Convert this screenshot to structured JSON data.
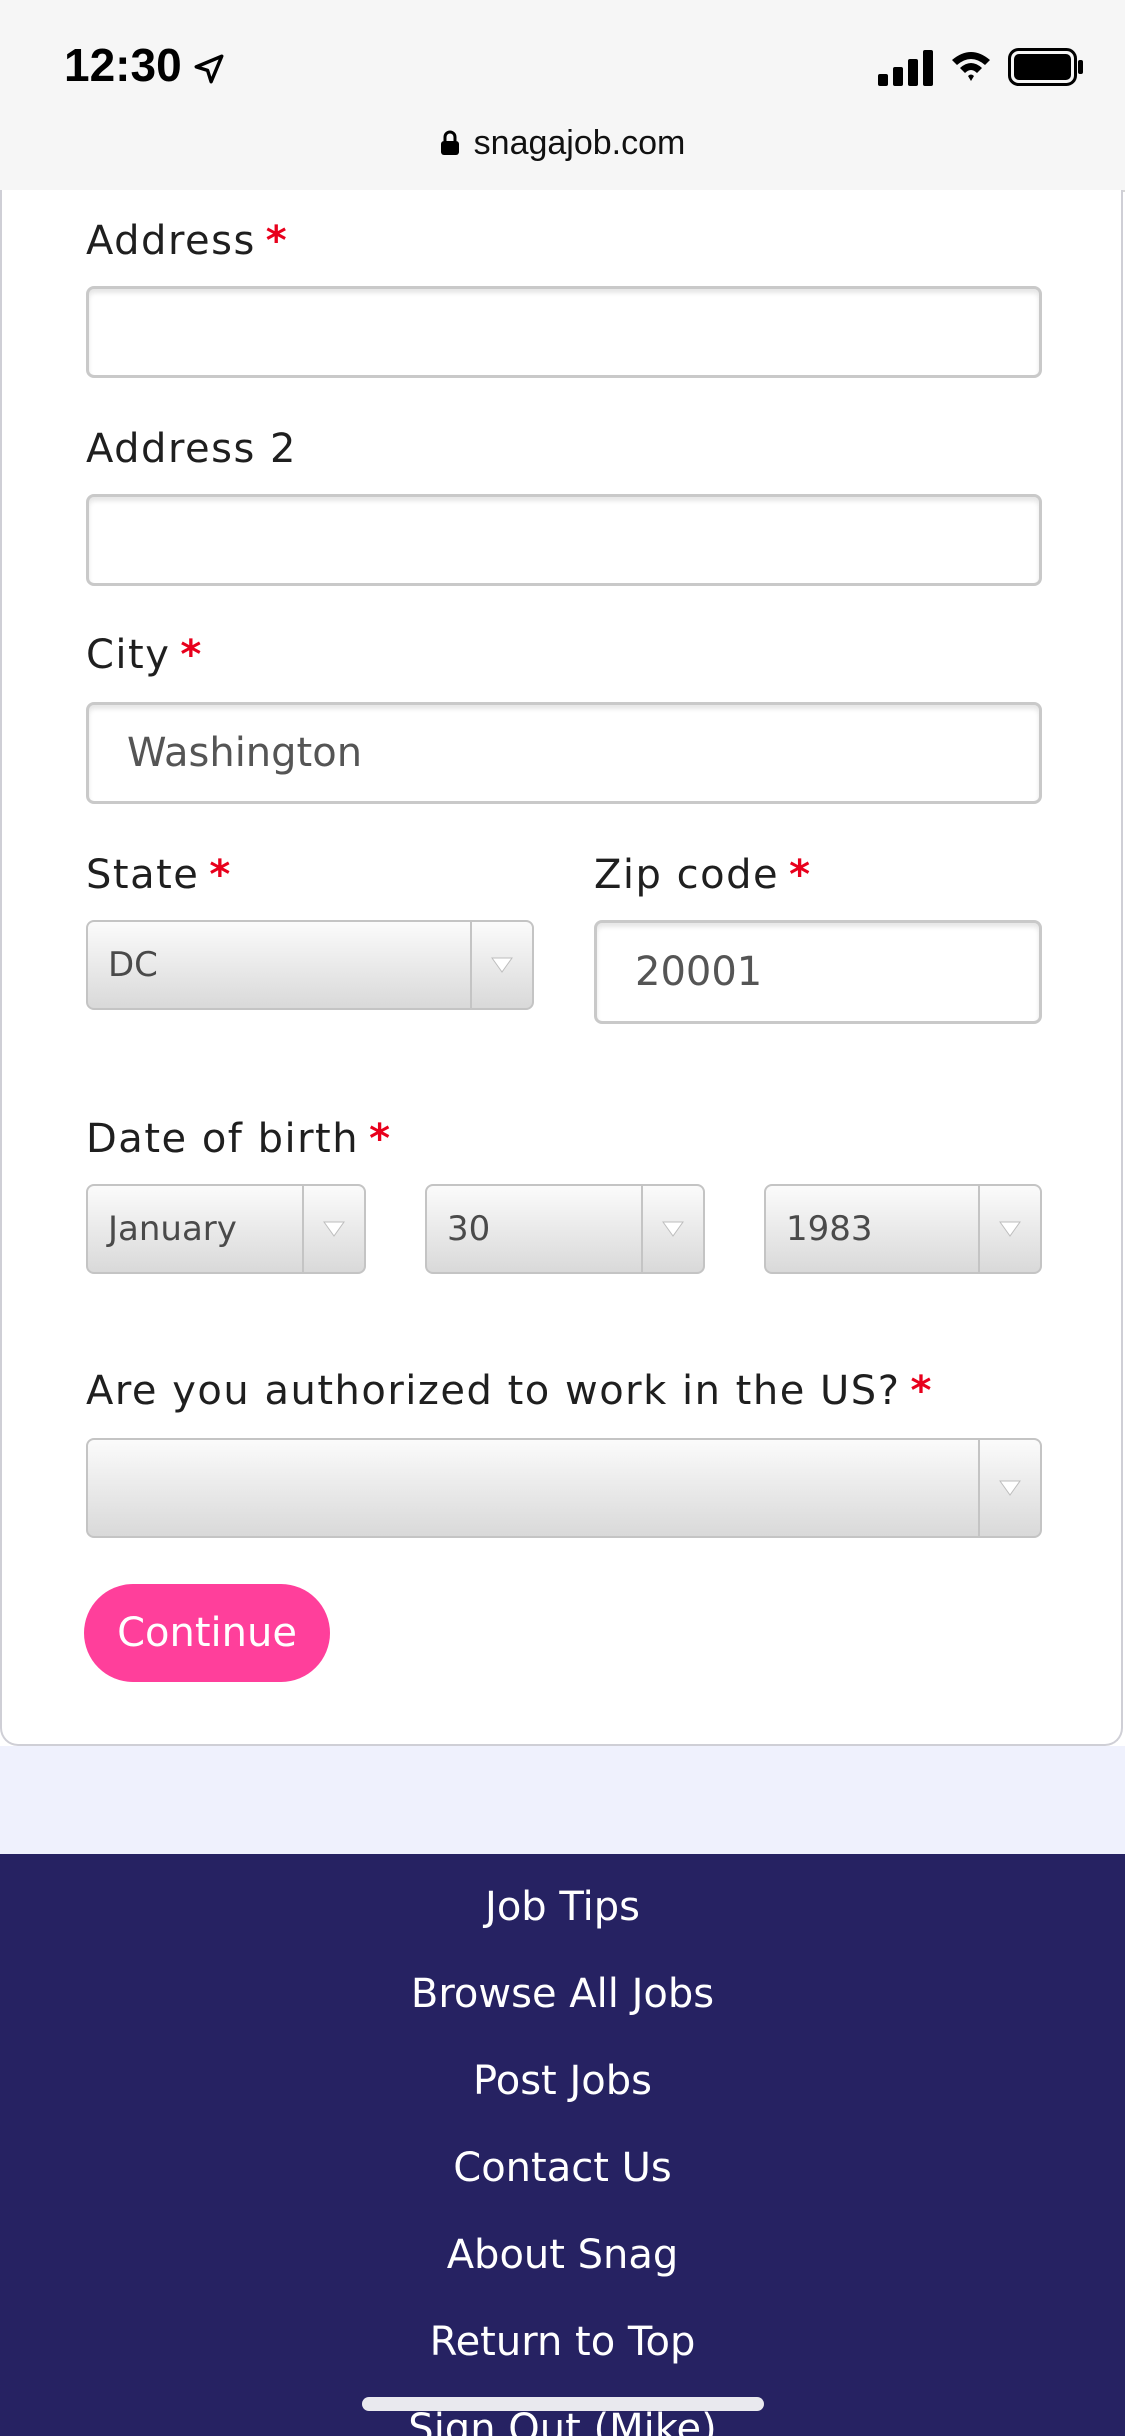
{
  "status_bar": {
    "time": "12:30",
    "url": "snagajob.com"
  },
  "form": {
    "address": {
      "label": "Address",
      "required_mark": "*",
      "value": ""
    },
    "address2": {
      "label": "Address 2",
      "value": ""
    },
    "city": {
      "label": "City",
      "required_mark": "*",
      "value": "Washington"
    },
    "state": {
      "label": "State",
      "required_mark": "*",
      "selected": "DC"
    },
    "zip": {
      "label": "Zip code",
      "required_mark": "*",
      "value": "20001"
    },
    "dob": {
      "label": "Date of birth",
      "required_mark": "*",
      "month": "January",
      "day": "30",
      "year": "1983"
    },
    "work_auth": {
      "label": "Are you authorized to work in the US?",
      "required_mark": "*",
      "selected": ""
    },
    "continue_label": "Continue"
  },
  "footer": {
    "links": [
      "Job Tips",
      "Browse All Jobs",
      "Post Jobs",
      "Contact Us",
      "About Snag",
      "Return to Top",
      "Sign Out (Mike)"
    ]
  },
  "colors": {
    "accent": "#ff3f9b",
    "footer_bg": "#262262",
    "required": "#e8001c",
    "page_gap": "#eff1fd"
  },
  "icons": [
    "location-arrow-icon",
    "cellular-signal-icon",
    "wifi-icon",
    "battery-icon",
    "lock-icon",
    "chevron-down-icon"
  ]
}
